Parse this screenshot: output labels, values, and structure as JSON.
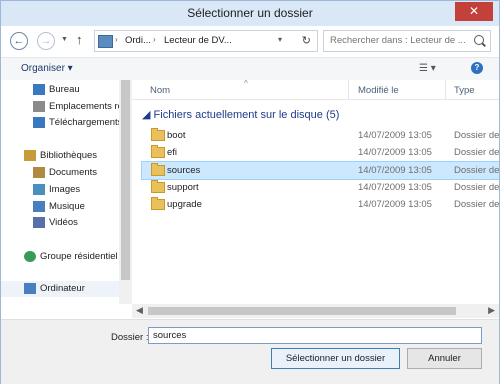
{
  "window": {
    "title": "Sélectionner un dossier",
    "close_label": "✕"
  },
  "address": {
    "back_icon": "back-arrow-icon",
    "forward_icon": "forward-arrow-icon",
    "segments": [
      "Ordi...",
      "Lecteur de DV..."
    ],
    "search_placeholder": "Rechercher dans : Lecteur de ..."
  },
  "toolbar": {
    "organiser_label": "Organiser ▾",
    "help_label": "?"
  },
  "nav": {
    "items": [
      {
        "label": "Bureau",
        "icon": "desktop-icon",
        "color": "#3a78c0"
      },
      {
        "label": "Emplacements ré",
        "icon": "recent-places-icon",
        "color": "#7a7a7a"
      },
      {
        "label": "Téléchargements",
        "icon": "downloads-icon",
        "color": "#3a78c0"
      },
      {
        "label": "Bibliothèques",
        "icon": "libraries-icon",
        "color": "#c79a3a"
      },
      {
        "label": "Documents",
        "icon": "documents-icon",
        "color": "#b08a40"
      },
      {
        "label": "Images",
        "icon": "images-icon",
        "color": "#4a8fbf"
      },
      {
        "label": "Musique",
        "icon": "music-icon",
        "color": "#4a7fbf"
      },
      {
        "label": "Vidéos",
        "icon": "videos-icon",
        "color": "#5a6fa8"
      },
      {
        "label": "Groupe résidentiel",
        "icon": "homegroup-icon",
        "color": "#3a9a5a"
      },
      {
        "label": "Ordinateur",
        "icon": "computer-icon",
        "color": "#4a7fbf"
      }
    ]
  },
  "columns": {
    "name": "Nom",
    "modified": "Modifié le",
    "type": "Type"
  },
  "group": {
    "title": "Fichiers actuellement sur le disque (5)"
  },
  "rows": [
    {
      "name": "boot",
      "date": "14/07/2009 13:05",
      "type": "Dossier de"
    },
    {
      "name": "efi",
      "date": "14/07/2009 13:05",
      "type": "Dossier de"
    },
    {
      "name": "sources",
      "date": "14/07/2009 13:05",
      "type": "Dossier de"
    },
    {
      "name": "support",
      "date": "14/07/2009 13:05",
      "type": "Dossier de"
    },
    {
      "name": "upgrade",
      "date": "14/07/2009 13:05",
      "type": "Dossier de"
    }
  ],
  "selected_row": "sources",
  "footer": {
    "dossier_label": "Dossier :",
    "dossier_value": "sources",
    "select_button": "Sélectionner un dossier",
    "cancel_button": "Annuler"
  }
}
